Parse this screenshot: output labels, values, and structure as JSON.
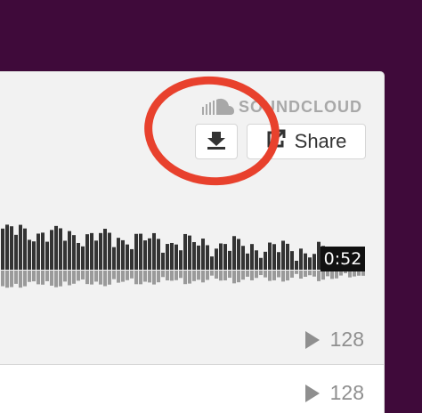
{
  "widget": {
    "brand_label": "SOUNDCLOUD",
    "icons": {
      "brand": "soundcloud-logo-icon",
      "download": "download-icon",
      "share": "share-icon",
      "play": "play-icon"
    },
    "share_label": "Share",
    "time_label": "0:52",
    "play_count_top": "128",
    "play_count_bottom": "128",
    "colors": {
      "background": "#3f0a3a",
      "annotation": "#e8412d",
      "waveform_dark": "#333333",
      "waveform_light": "#999999",
      "text_muted": "#8f8f8f"
    }
  }
}
